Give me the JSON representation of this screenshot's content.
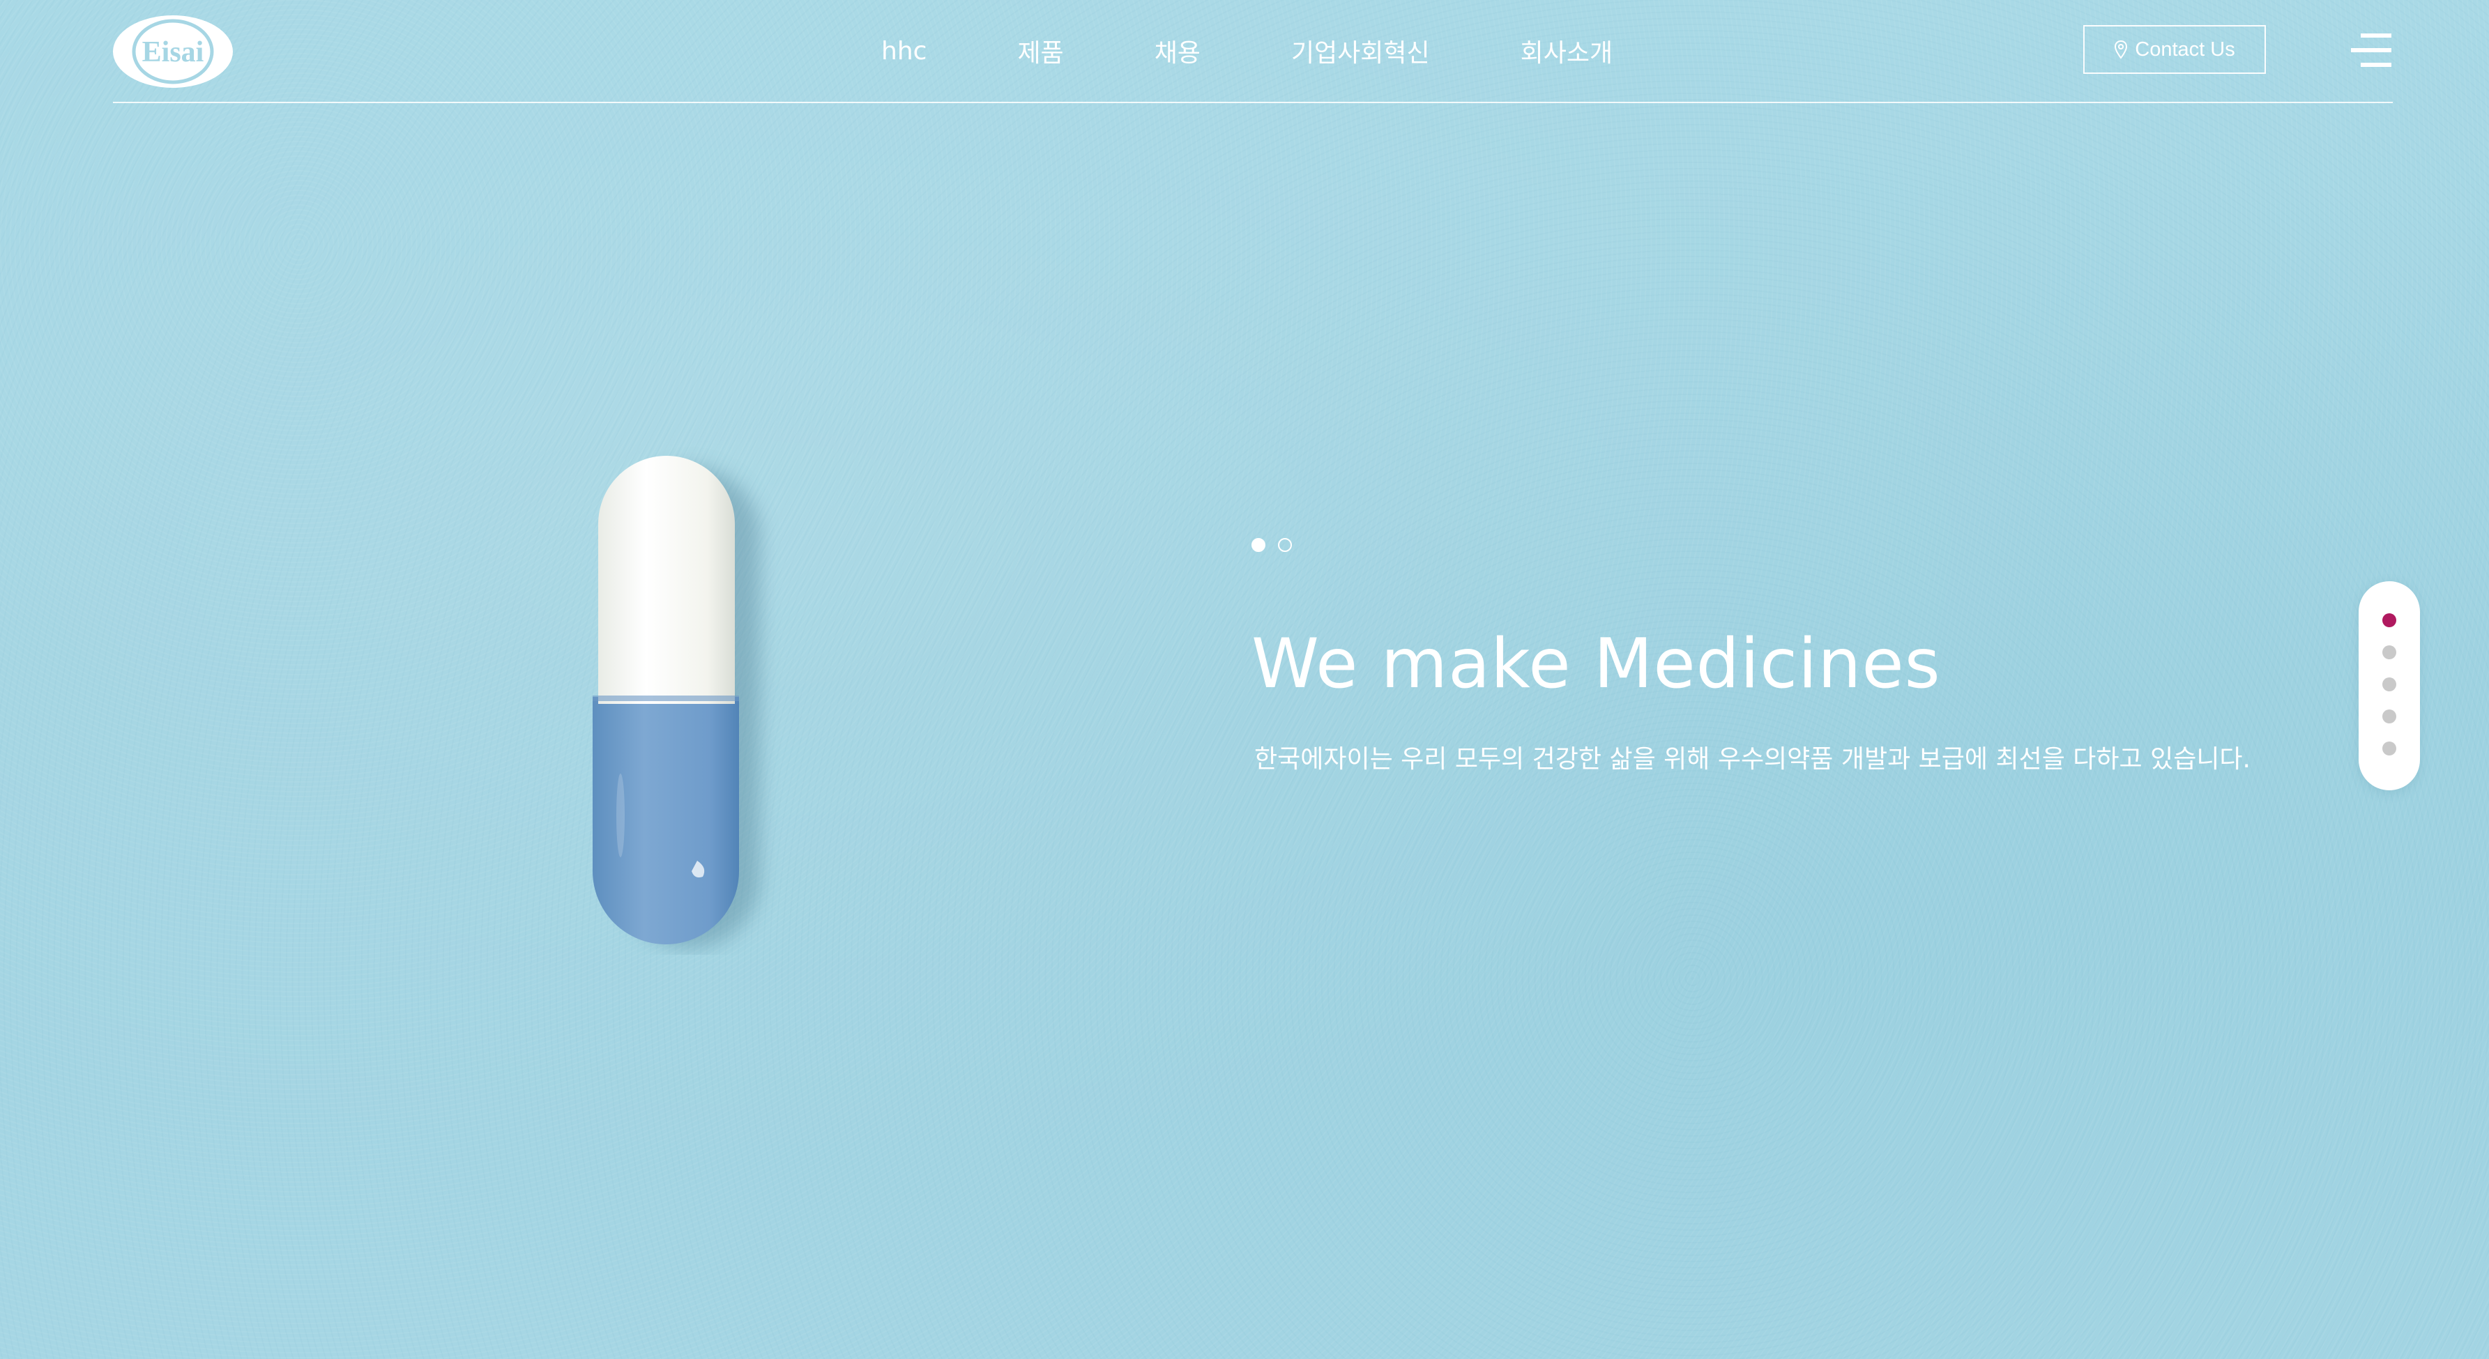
{
  "brand": {
    "logo_text": "Eisai",
    "logo_icon": "eisai-logo"
  },
  "header": {
    "nav": [
      {
        "label": "hhc"
      },
      {
        "label": "제품"
      },
      {
        "label": "채용"
      },
      {
        "label": "기업사회혁신"
      },
      {
        "label": "회사소개"
      }
    ],
    "contact": {
      "label": "Contact Us",
      "icon": "location-pin-icon"
    },
    "menu_icon": "hamburger-menu-icon"
  },
  "hero": {
    "title": "We make Medicines",
    "subtitle": "한국에자이는 우리 모두의 건강한 삶을 위해 우수의약품 개발과 보급에 최선을 다하고 있습니다.",
    "slide_count": 2,
    "active_slide": 1,
    "image": "capsule-pill"
  },
  "section_pager": {
    "count": 5,
    "active": 1
  },
  "colors": {
    "background": "#a6d6e4",
    "text": "#ffffff",
    "accent": "#b0195f",
    "pager_inactive": "#c9c9c9"
  }
}
